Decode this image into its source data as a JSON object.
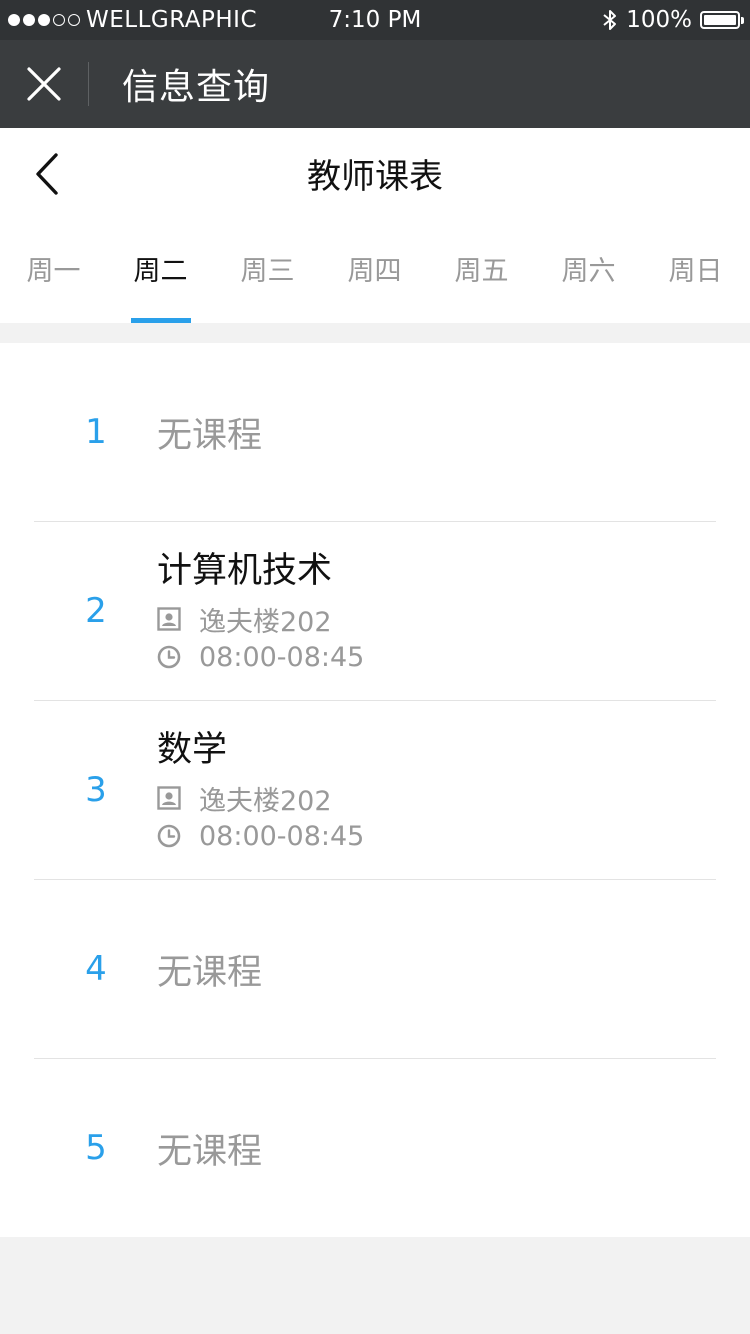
{
  "status_bar": {
    "carrier": "WELLGRAPHIC",
    "signal_full": 3,
    "signal_total": 5,
    "time": "7:10 PM",
    "battery": "100%"
  },
  "app_bar": {
    "title": "信息查询",
    "close_icon": "close-icon"
  },
  "nav": {
    "title": "教师课表",
    "back_icon": "chevron-left-icon"
  },
  "tabs": [
    {
      "label": "周一",
      "active": false
    },
    {
      "label": "周二",
      "active": true
    },
    {
      "label": "周三",
      "active": false
    },
    {
      "label": "周四",
      "active": false
    },
    {
      "label": "周五",
      "active": false
    },
    {
      "label": "周六",
      "active": false
    },
    {
      "label": "周日",
      "active": false
    }
  ],
  "periods": [
    {
      "number": "1",
      "empty_text": "无课程"
    },
    {
      "number": "2",
      "course": "计算机技术",
      "location": "逸夫楼202",
      "time": "08:00-08:45"
    },
    {
      "number": "3",
      "course": "数学",
      "location": "逸夫楼202",
      "time": "08:00-08:45"
    },
    {
      "number": "4",
      "empty_text": "无课程"
    },
    {
      "number": "5",
      "empty_text": "无课程"
    }
  ],
  "colors": {
    "accent": "#2aa0ea",
    "status_bar_bg": "#303335",
    "app_bar_bg": "#3a3d3f",
    "muted_text": "#999999"
  }
}
